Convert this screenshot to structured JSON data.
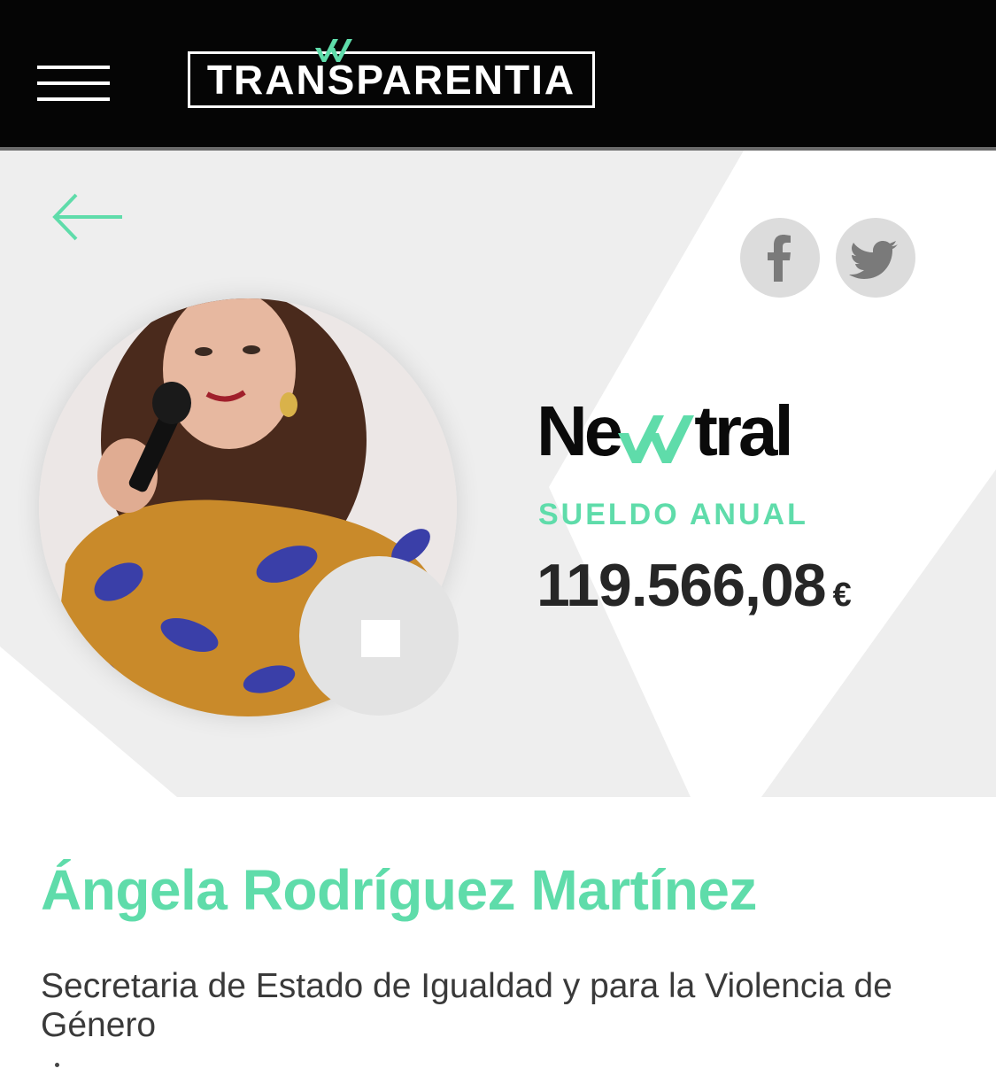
{
  "header": {
    "logo_text": "TRANSPARENTIA",
    "menu_icon": "hamburger-menu-icon"
  },
  "nav": {
    "back_icon": "arrow-left-icon"
  },
  "share": {
    "facebook_icon": "facebook-icon",
    "twitter_icon": "twitter-icon"
  },
  "brand": {
    "prefix": "Ne",
    "suffix": "tral"
  },
  "salary": {
    "label": "SUELDO ANUAL",
    "amount": "119.566,08",
    "currency": "€"
  },
  "person": {
    "name": "Ángela Rodríguez Martínez",
    "role": "Secretaria de Estado de Igualdad y para la Violencia de Género"
  },
  "colors": {
    "accent": "#5fdcaa",
    "header_bg": "#050505",
    "hero_bg": "#eeeeee"
  }
}
